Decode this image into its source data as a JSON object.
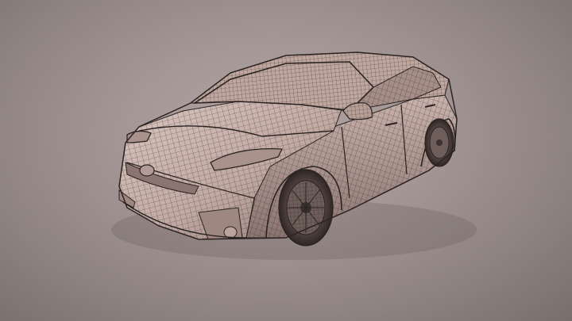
{
  "viewer": {
    "colors": {
      "background": "#a49796",
      "mesh_fill": "#c9b3ad",
      "wire": "#2b2322",
      "shade": "#6e5e5a"
    },
    "model": {
      "display_mode": "wireframe-on-shaded"
    }
  }
}
